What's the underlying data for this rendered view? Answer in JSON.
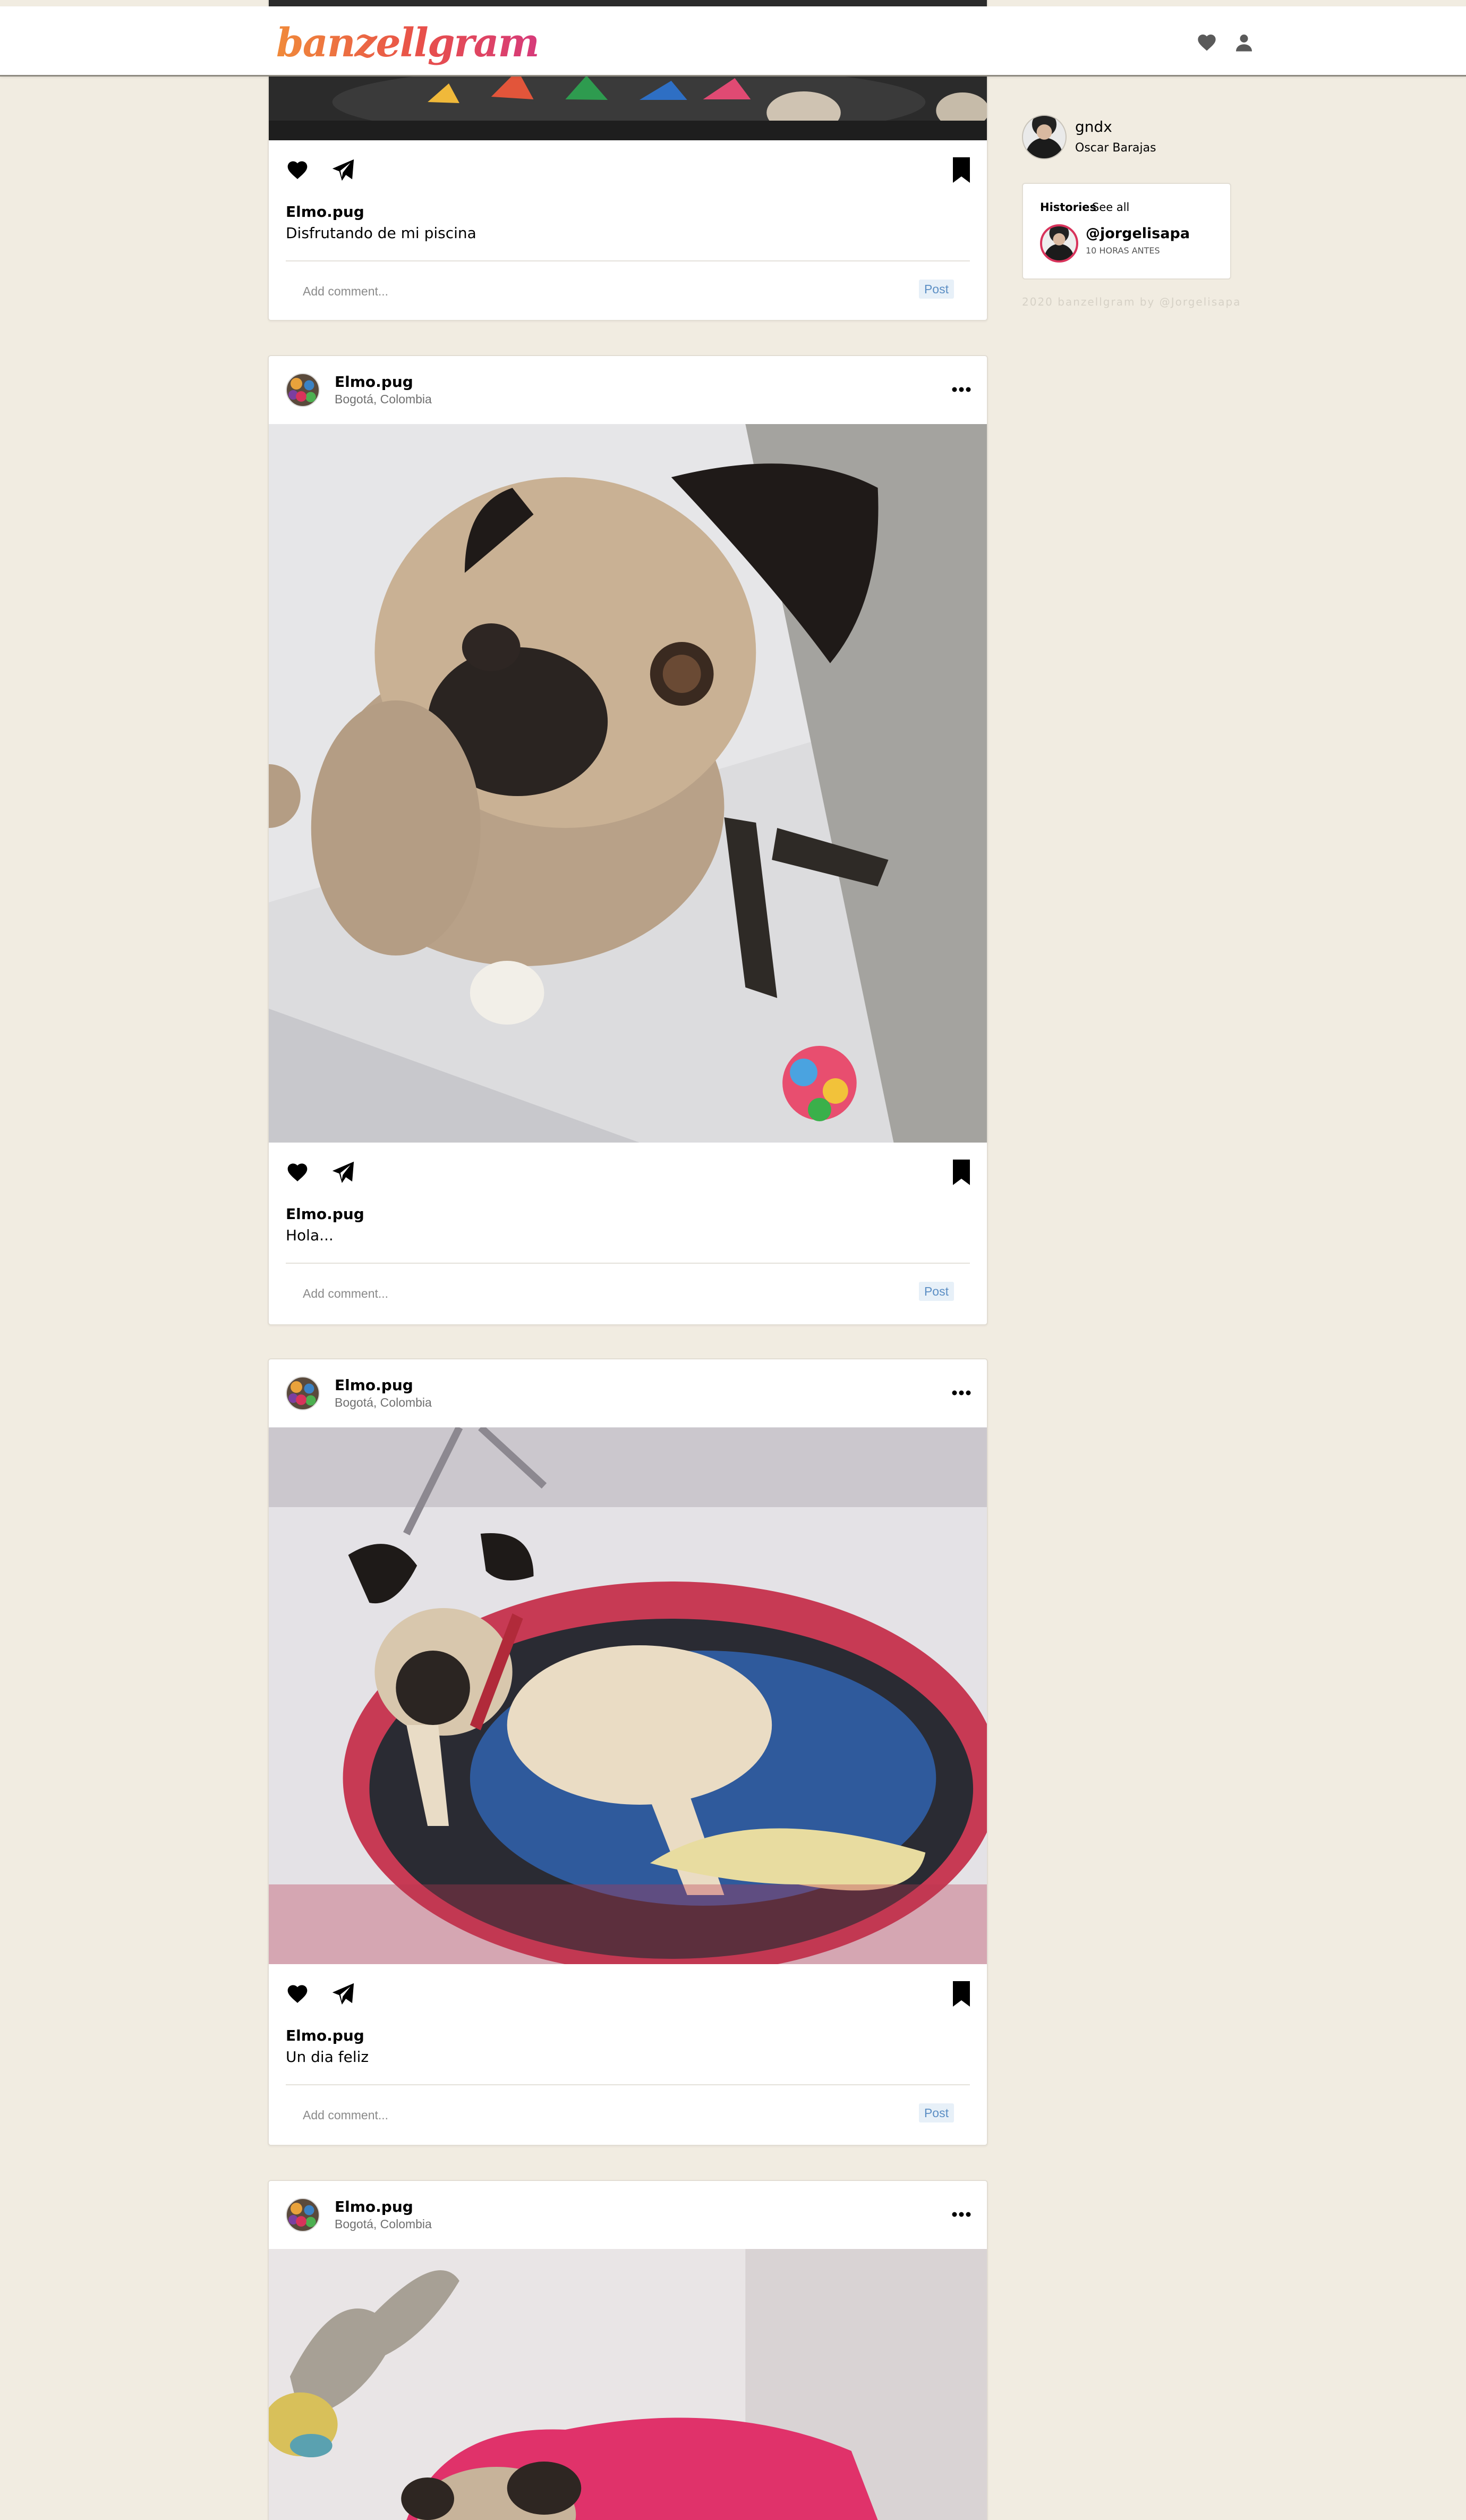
{
  "header": {
    "logo": "banzellgram",
    "icons": [
      "heart-icon",
      "user-icon"
    ]
  },
  "sidebar": {
    "profile": {
      "username": "gndx",
      "name": "Oscar Barajas"
    },
    "stories": {
      "title": "Histories",
      "see_all": "See all",
      "items": [
        {
          "username": "@jorgelisapa",
          "time": "10 HORAS ANTES"
        }
      ]
    },
    "footer": "2020 banzellgram by @Jorgelisapa"
  },
  "posts": [
    {
      "username": "Elmo.pug",
      "caption_user": "Elmo.pug",
      "caption": "Disfrutando de mi piscina",
      "comment_placeholder": "Add comment...",
      "post_label": "Post"
    },
    {
      "username": "Elmo.pug",
      "location": "Bogotá, Colombia",
      "caption_user": "Elmo.pug",
      "caption": "Hola...",
      "comment_placeholder": "Add comment...",
      "post_label": "Post"
    },
    {
      "username": "Elmo.pug",
      "location": "Bogotá, Colombia",
      "caption_user": "Elmo.pug",
      "caption": "Un dia feliz",
      "comment_placeholder": "Add comment...",
      "post_label": "Post"
    },
    {
      "username": "Elmo.pug",
      "location": "Bogotá, Colombia"
    }
  ],
  "colors": {
    "background": "#f1ece1",
    "logo_gradient": [
      "#f08a3a",
      "#d63a7a"
    ],
    "post_button": "#5b8ec4"
  }
}
